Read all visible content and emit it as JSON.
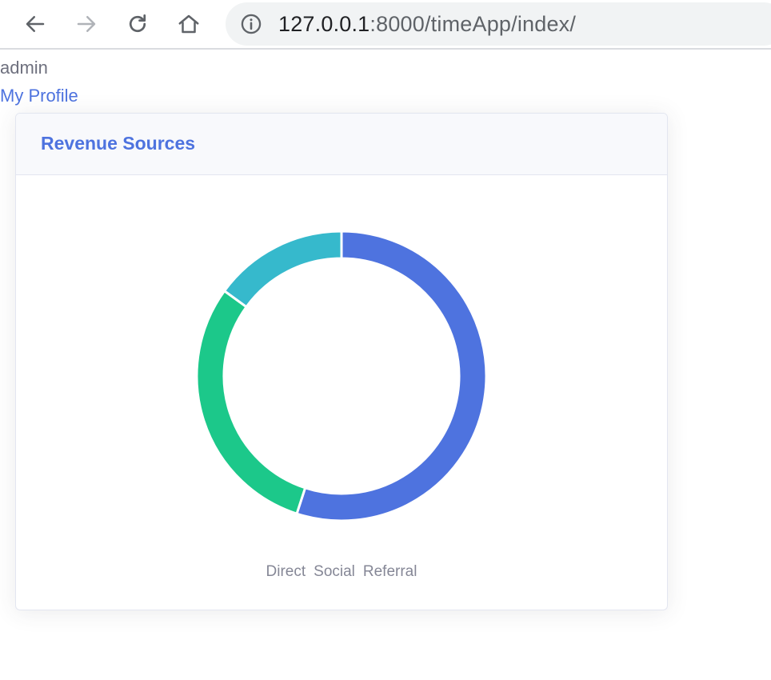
{
  "browser": {
    "url_host": "127.0.0.1",
    "url_rest": ":8000/timeApp/index/",
    "icons": {
      "back": "arrow-left-icon",
      "forward": "arrow-right-icon",
      "reload": "reload-icon",
      "home": "home-icon",
      "info": "info-icon"
    }
  },
  "user": {
    "name": "admin",
    "profile_link": "My Profile"
  },
  "card": {
    "title": "Revenue Sources"
  },
  "chart_data": {
    "type": "pie",
    "subtype": "doughnut",
    "categories": [
      "Direct",
      "Social",
      "Referral"
    ],
    "values": [
      55,
      30,
      15
    ],
    "colors": [
      "#4e73df",
      "#1cc88a",
      "#36b9cc"
    ],
    "legend": "bottom"
  },
  "colors": {
    "accent": "#4e73df",
    "text_muted": "#858796"
  }
}
